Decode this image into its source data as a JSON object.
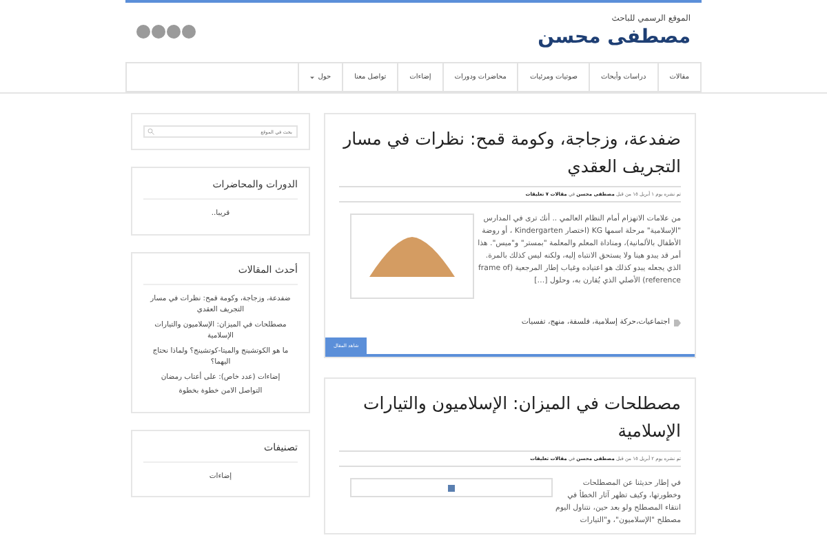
{
  "header": {
    "tagline": "الموقع الرسمي للباحث",
    "site_title": "مصطفى محسن"
  },
  "nav": {
    "items": [
      {
        "label": "مقالات",
        "dropdown": false
      },
      {
        "label": "دراسات وأبحاث",
        "dropdown": false
      },
      {
        "label": "صوتيات ومرئيات",
        "dropdown": false
      },
      {
        "label": "محاضرات ودورات",
        "dropdown": false
      },
      {
        "label": "إضاءات",
        "dropdown": false
      },
      {
        "label": "تواصل معنا",
        "dropdown": false
      },
      {
        "label": "حول",
        "dropdown": true
      }
    ]
  },
  "posts": [
    {
      "title": "ضفدعة، وزجاجة، وكومة قمح: نظرات في مسار التجريف العقدي",
      "meta_prefix": "تم نشره يوم ١ أبريل ١٥ من قبل",
      "author": "مصطفى محسن",
      "meta_in": "في",
      "category": "مقالات",
      "comments": "٧ تعليقات",
      "kind": "photo",
      "excerpt": "من علامات الانهزام أمام النظام العالمي .. أنك ترى في المدارس \"الإسلامية\" مرحلة اسمها KG (اختصار Kindergarten ، أو روضة الأطفال بالألمانية)، ومناداة المعلم والمعلمة \"بمستر\" و\"ميس\". هذا أمر قد يبدو هينا ولا يستحق الانتباه إليه، ولكنه ليس كذلك بالمرة. الذي يجعله يبدو كذلك هو اعتياده وغياب إطار المرجعية (frame of reference) الأصلي الذي يُقارن به، وحلول […]",
      "tags": "اجتماعيات،حركة إسلامية، فلسفة، منهج، تفسيات",
      "read_more": "شاهد المقال"
    },
    {
      "title": "مصطلحات في الميزان: الإسلاميون والتيارات الإسلامية",
      "meta_prefix": "تم نشره يوم ٢ أبريل ١٥ من قبل",
      "author": "مصطفى محسن",
      "meta_in": "في",
      "category": "مقالات",
      "comments": "تعليقات",
      "kind": "broken",
      "excerpt": "في إطار حديثنا عن المصطلحات وخطورتها، وكيف تظهر آثار الخطأ في انتقاء المصطلح ولو بعد حين، نتناول اليوم مصطلح \"الإسلاميون\"، و\"التيارات"
    }
  ],
  "sidebar": {
    "search": {
      "placeholder": "بحث في الموقع"
    },
    "widgets": [
      {
        "title": "الدورات والمحاضرات",
        "items": [
          "قريبا.."
        ]
      },
      {
        "title": "أحدث المقالات",
        "items": [
          "ضفدعة، وزجاجة، وكومة قمح: نظرات في مسار التجريف العقدي",
          "مصطلحات في الميزان: الإسلاميون والتيارات الإسلامية",
          "ما هو الكوتشينج والميتا-كوتشينج؟ ولماذا نحتاج اليهما؟",
          "إضاءات (عدد خاص): على أعتاب رمضان",
          "التواصل الامن خطوة بخطوة"
        ]
      },
      {
        "title": "تصنيفات",
        "items": [
          "إضاءات"
        ]
      }
    ]
  }
}
